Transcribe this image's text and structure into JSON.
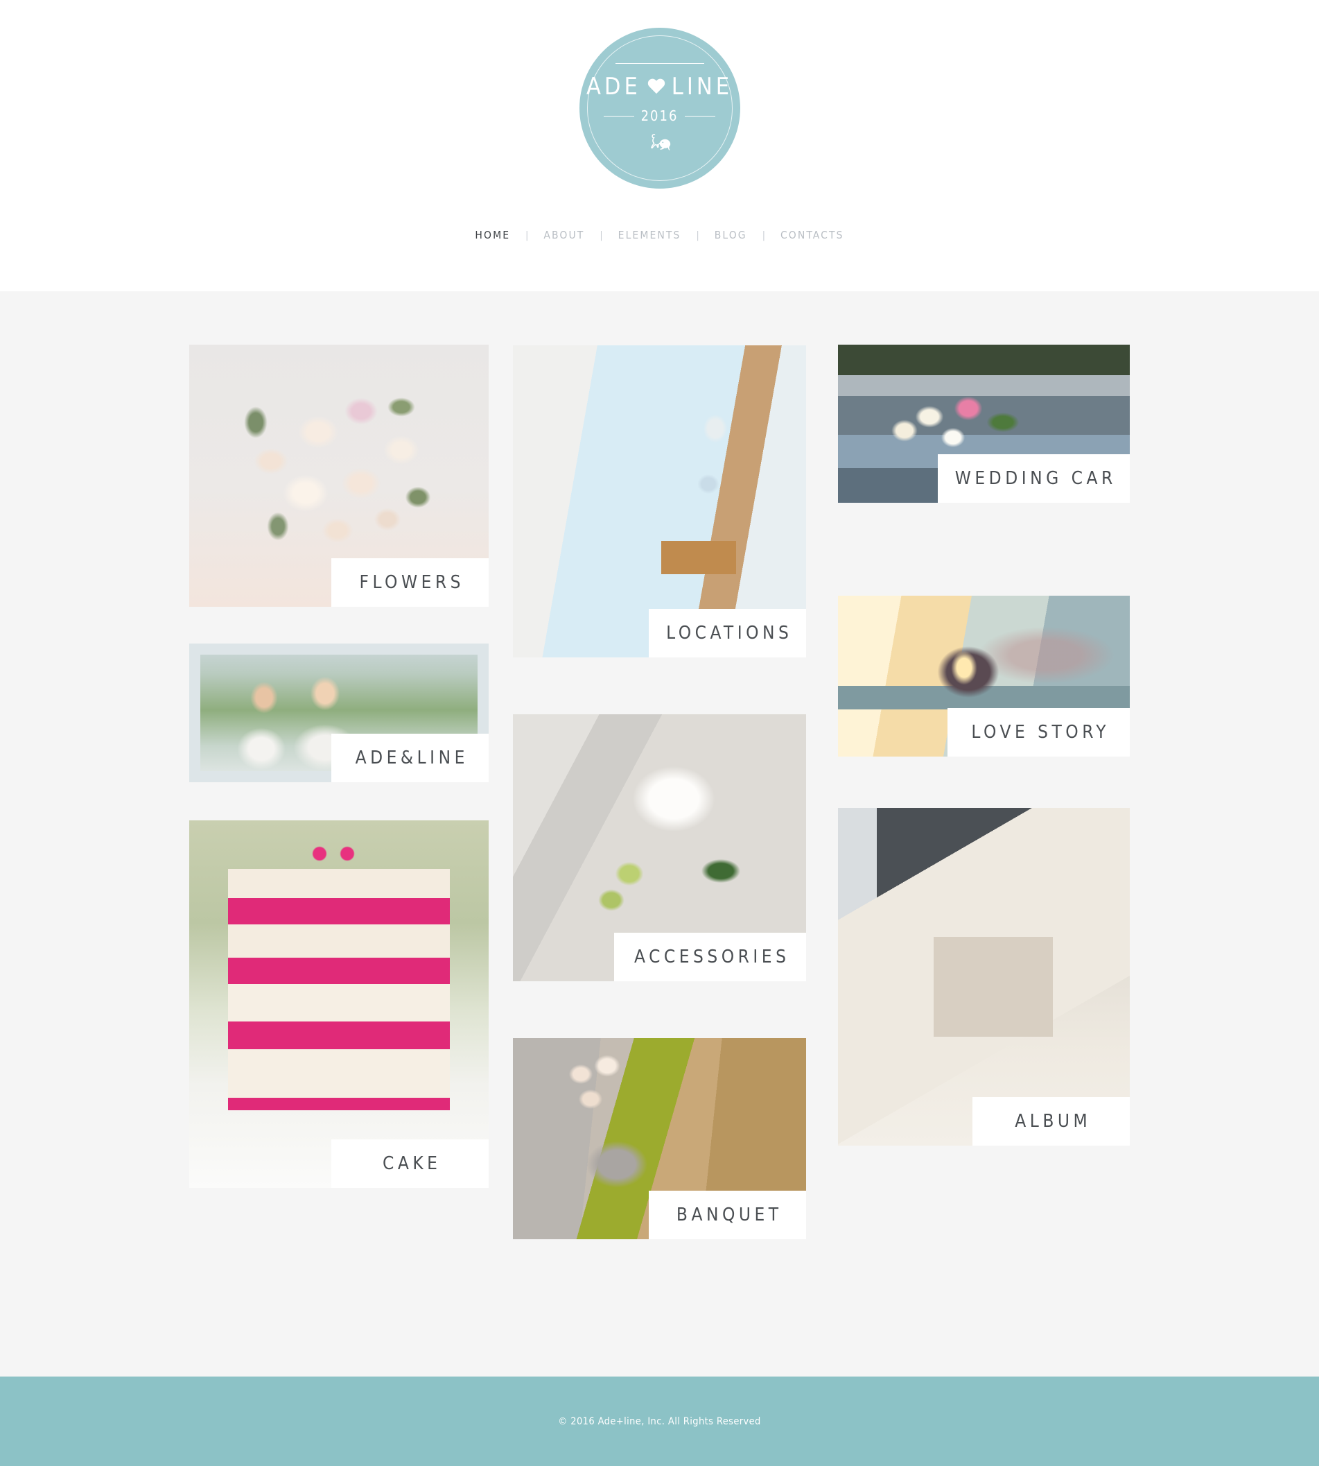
{
  "header": {
    "logo": {
      "name_left": "ADE",
      "name_right": "LINE",
      "heart_icon": "heart-icon",
      "year": "2016",
      "ornament_icon": "swan-bird-icon",
      "background_color": "#9ecbd1"
    },
    "nav": {
      "separator": "|",
      "items": [
        {
          "label": "HOME",
          "active": true
        },
        {
          "label": "ABOUT",
          "active": false
        },
        {
          "label": "ELEMENTS",
          "active": false
        },
        {
          "label": "BLOG",
          "active": false
        },
        {
          "label": "CONTACTS",
          "active": false
        }
      ]
    }
  },
  "gallery": {
    "tiles": [
      {
        "key": "flowers",
        "label": "FLOWERS"
      },
      {
        "key": "adeline",
        "label": "ADE&LINE"
      },
      {
        "key": "cake",
        "label": "CAKE"
      },
      {
        "key": "locations",
        "label": "LOCATIONS"
      },
      {
        "key": "accessories",
        "label": "ACCESSORIES"
      },
      {
        "key": "banquet",
        "label": "BANQUET"
      },
      {
        "key": "weddingcar",
        "label": "WEDDING CAR"
      },
      {
        "key": "lovestory",
        "label": "LOVE STORY"
      },
      {
        "key": "album",
        "label": "ALBUM"
      }
    ]
  },
  "footer": {
    "copyright": "© 2016 Ade+line, Inc. All Rights Reserved",
    "background_color": "#8cc2c6"
  },
  "theme": {
    "page_background": "#f5f5f5",
    "header_background": "#ffffff",
    "accent": "#8cc2c6",
    "caption_text": "#4a4e52",
    "nav_inactive": "#b9bec4",
    "nav_active": "#3f4347"
  }
}
